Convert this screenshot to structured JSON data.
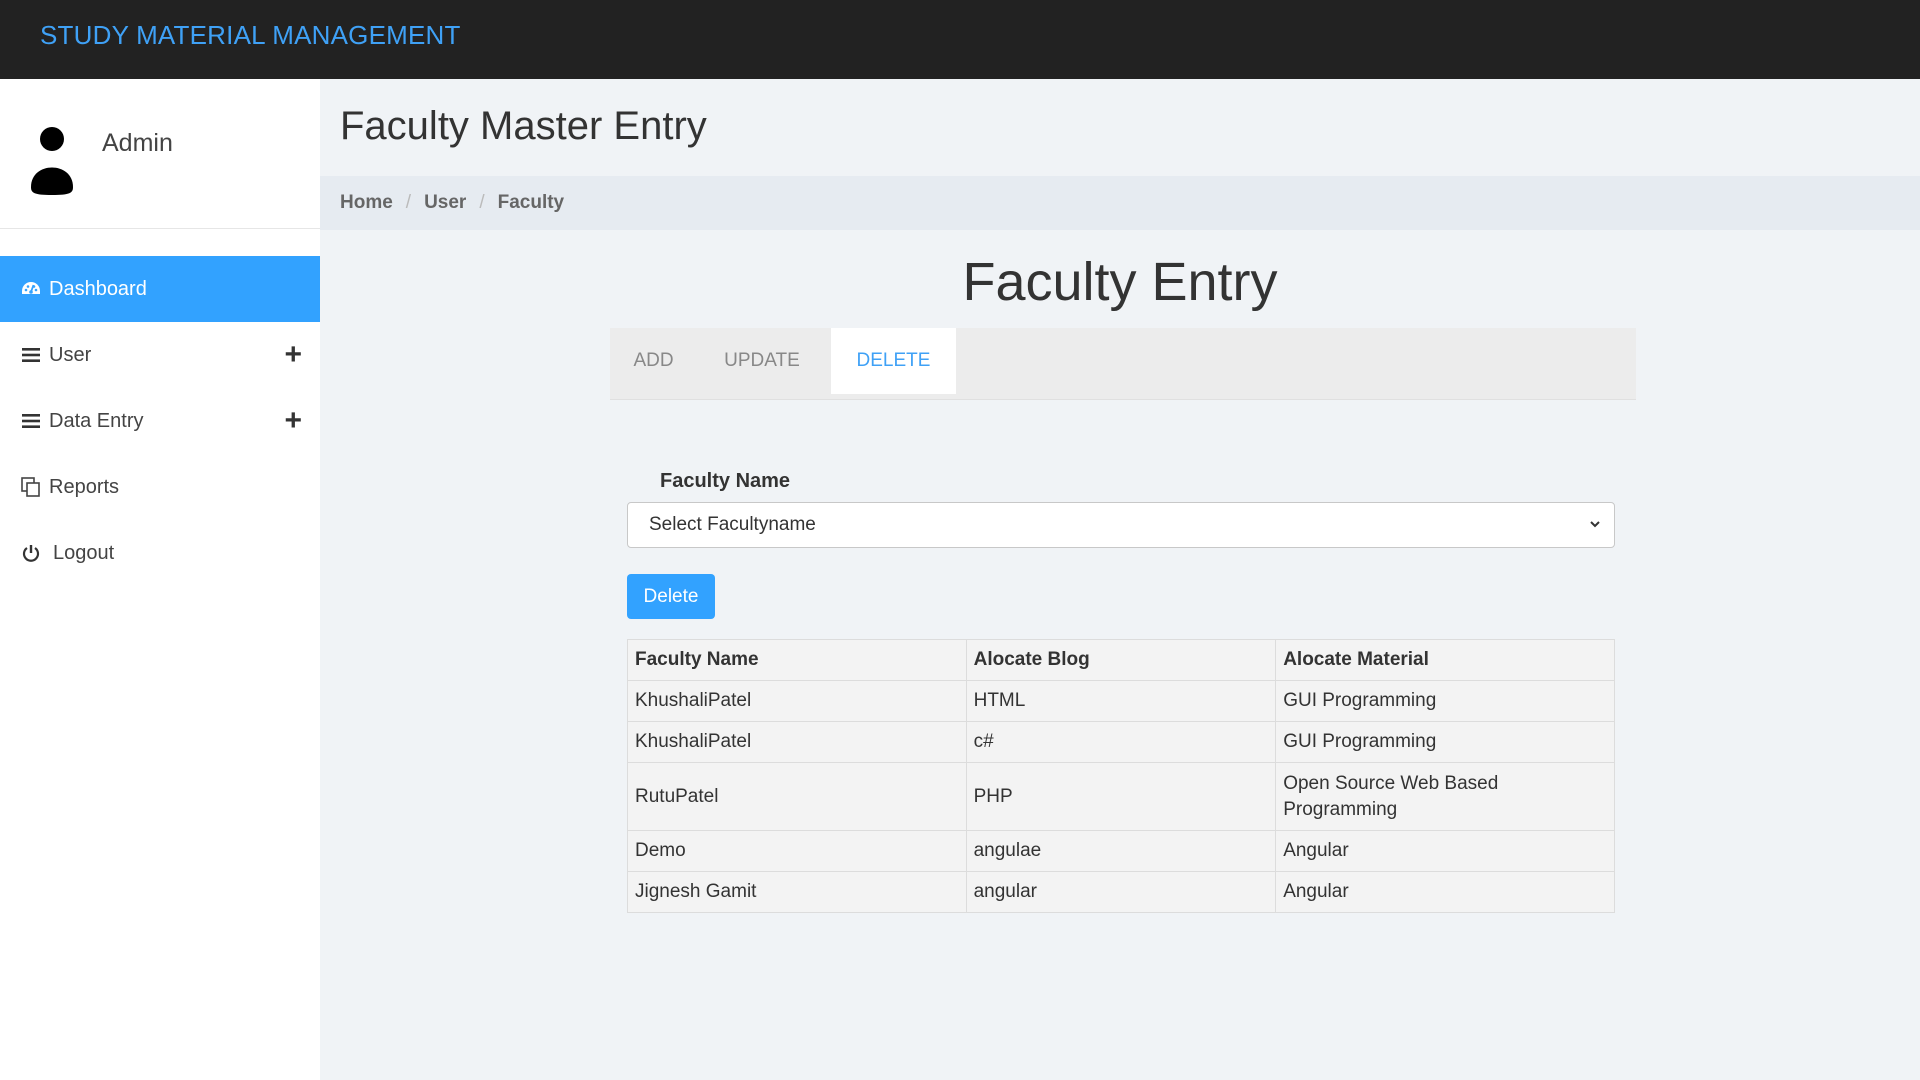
{
  "app": {
    "title": "STUDY MATERIAL MANAGEMENT"
  },
  "user": {
    "name": "Admin"
  },
  "sidebar": {
    "items": [
      {
        "label": "Dashboard",
        "icon": "dashboard-icon",
        "active": true
      },
      {
        "label": "User",
        "icon": "bars-icon",
        "expandable": true
      },
      {
        "label": "Data Entry",
        "icon": "bars-icon",
        "expandable": true
      },
      {
        "label": "Reports",
        "icon": "copy-icon"
      },
      {
        "label": "Logout",
        "icon": "power-icon"
      }
    ],
    "expand_symbol": "+"
  },
  "page": {
    "header": "Faculty Master Entry"
  },
  "breadcrumb": {
    "items": [
      "Home",
      "User",
      "Faculty"
    ],
    "separator": "/"
  },
  "content": {
    "title": "Faculty Entry",
    "tabs": [
      {
        "label": "ADD"
      },
      {
        "label": "UPDATE"
      },
      {
        "label": "DELETE",
        "active": true
      }
    ],
    "form": {
      "faculty_label": "Faculty Name",
      "faculty_select_value": "Select Facultyname",
      "delete_label": "Delete"
    },
    "table": {
      "headers": [
        "Faculty Name",
        "Alocate Blog",
        "Alocate Material"
      ],
      "rows": [
        [
          "KhushaliPatel",
          "HTML",
          "GUI Programming"
        ],
        [
          "KhushaliPatel",
          "c#",
          "GUI Programming"
        ],
        [
          "RutuPatel",
          "PHP",
          "Open Source Web Based Programming"
        ],
        [
          "Demo",
          "angulae",
          "Angular"
        ],
        [
          "Jignesh Gamit",
          "angular",
          "Angular"
        ]
      ]
    }
  },
  "colors": {
    "accent": "#32a2ff",
    "brand": "#3fa1f6",
    "topbar": "#222222"
  }
}
